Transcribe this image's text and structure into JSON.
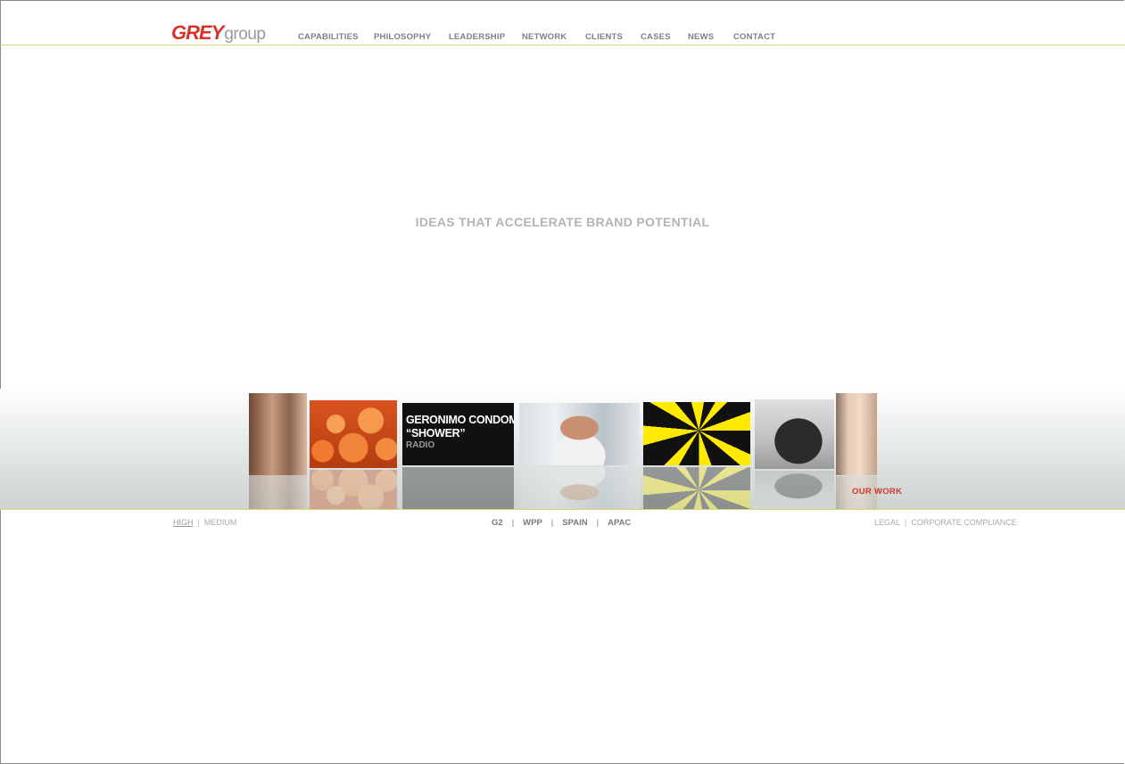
{
  "logo": {
    "part1": "GREY",
    "part2": "group"
  },
  "nav": [
    "CAPABILITIES",
    "PHILOSOPHY",
    "LEADERSHIP",
    "NETWORK",
    "CLIENTS",
    "CASES",
    "NEWS",
    "CONTACT"
  ],
  "tagline": "IDEAS THAT ACCELERATE BRAND POTENTIAL",
  "carousel": {
    "featured_line1": "GERONIMO CONDOMS",
    "featured_line2": "“SHOWER”",
    "featured_line3": "RADIO",
    "link": "OUR WORK"
  },
  "footer": {
    "quality": [
      "HIGH",
      "MEDIUM"
    ],
    "sites": [
      "G2",
      "WPP",
      "SPAIN",
      "APAC"
    ],
    "legal": [
      "LEGAL",
      "CORPORATE COMPLIANCE"
    ]
  },
  "colors": {
    "brand_red": "#d9322a",
    "rule": "#d6d77a",
    "nav_text": "#808080"
  }
}
